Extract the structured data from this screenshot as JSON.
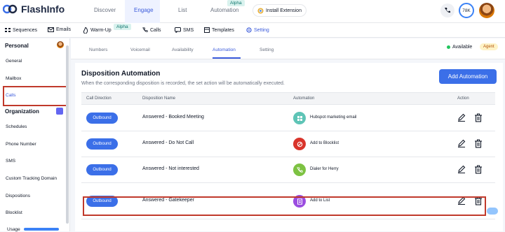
{
  "brand": {
    "name": "FlashInfo"
  },
  "top_nav": {
    "items": [
      "Discover",
      "Engage",
      "List",
      "Automation"
    ],
    "active": "Engage",
    "alpha_label": "Alpha",
    "install_label": "Install Extension",
    "credits": "78K"
  },
  "sub_nav": {
    "items": [
      "Sequences",
      "Emails",
      "Warm-Up",
      "Calls",
      "SMS",
      "Templates",
      "Setting"
    ],
    "alpha_label": "Alpha",
    "active": "Setting"
  },
  "sidebar": {
    "personal_title": "Personal",
    "personal_items": [
      "General",
      "Mailbox",
      "Calls"
    ],
    "org_title": "Organization",
    "org_items": [
      "Schedules",
      "Phone Number",
      "SMS",
      "Custom Tracking Domain",
      "Dispositions",
      "Blocklist"
    ],
    "usage_label": "Usage"
  },
  "tabs": {
    "items": [
      "Numbers",
      "Voicemail",
      "Availability",
      "Automation",
      "Setting"
    ],
    "active": "Automation",
    "status": "Available",
    "role_badge": "Agent"
  },
  "section": {
    "title": "Disposition Automation",
    "description": "When the corresponding disposition is recorded, the set action will be automatically executed.",
    "add_button": "Add Automation"
  },
  "table": {
    "headers": [
      "Call Direction",
      "Disposition Name",
      "Automation",
      "Action"
    ],
    "rows": [
      {
        "direction": "Outbound",
        "disposition": "Answered - Booked Meeting",
        "automation": "Hubspot marketing email",
        "icon": "hubspot-icon",
        "color": "#5ec4b6"
      },
      {
        "direction": "Outbound",
        "disposition": "Answered - Do Not Call",
        "automation": "Add to Blocklist",
        "icon": "block-icon",
        "color": "#d9342b"
      },
      {
        "direction": "Outbound",
        "disposition": "Answered - Not interested",
        "automation": "Dialer for Herry",
        "icon": "phone-icon",
        "color": "#7dc242"
      },
      {
        "direction": "Outbound",
        "disposition": "Answered - Gatekeeper",
        "automation": "Add to List",
        "icon": "list-icon",
        "color": "#9b4de0"
      }
    ]
  },
  "colors": {
    "primary": "#3b6fe8",
    "highlight": "#c0392b"
  }
}
